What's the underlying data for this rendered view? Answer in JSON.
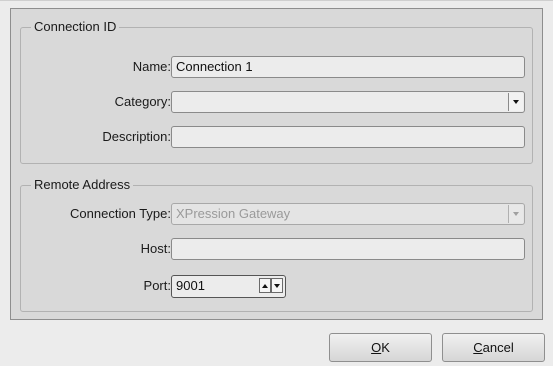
{
  "connection_id": {
    "title": "Connection ID",
    "name_label": "Name:",
    "name_value": "Connection 1",
    "category_label": "Category:",
    "category_value": "",
    "description_label": "Description:",
    "description_value": ""
  },
  "remote_address": {
    "title": "Remote Address",
    "connection_type_label": "Connection Type:",
    "connection_type_value": "XPression Gateway",
    "host_label": "Host:",
    "host_value": "",
    "port_label": "Port:",
    "port_value": "9001"
  },
  "buttons": {
    "ok_mnemonic": "O",
    "ok_rest": "K",
    "cancel_mnemonic": "C",
    "cancel_rest": "ancel"
  }
}
